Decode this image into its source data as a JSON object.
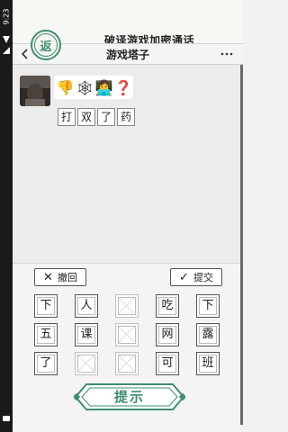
{
  "status": {
    "time": "9:23"
  },
  "header": {
    "logo_char": "返",
    "title": "破译游戏加密通话"
  },
  "nav": {
    "title": "游戏塔子",
    "back_icon": "chevron-left-icon",
    "more_icon": "ellipsis-icon"
  },
  "chat": {
    "emojis": [
      "👎",
      "🕸",
      "👩‍💻",
      "❓"
    ],
    "answer": [
      "打",
      "双",
      "了",
      "药"
    ]
  },
  "actions": {
    "undo_label": "撤回",
    "submit_label": "提交"
  },
  "grid": [
    [
      "下",
      "人",
      "",
      "吃",
      "下"
    ],
    [
      "五",
      "课",
      "",
      "网",
      "露"
    ],
    [
      "了",
      "",
      "",
      "可",
      "班"
    ]
  ],
  "hint": {
    "label": "提示"
  },
  "colors": {
    "accent": "#3e8d74",
    "border": "#555555"
  }
}
